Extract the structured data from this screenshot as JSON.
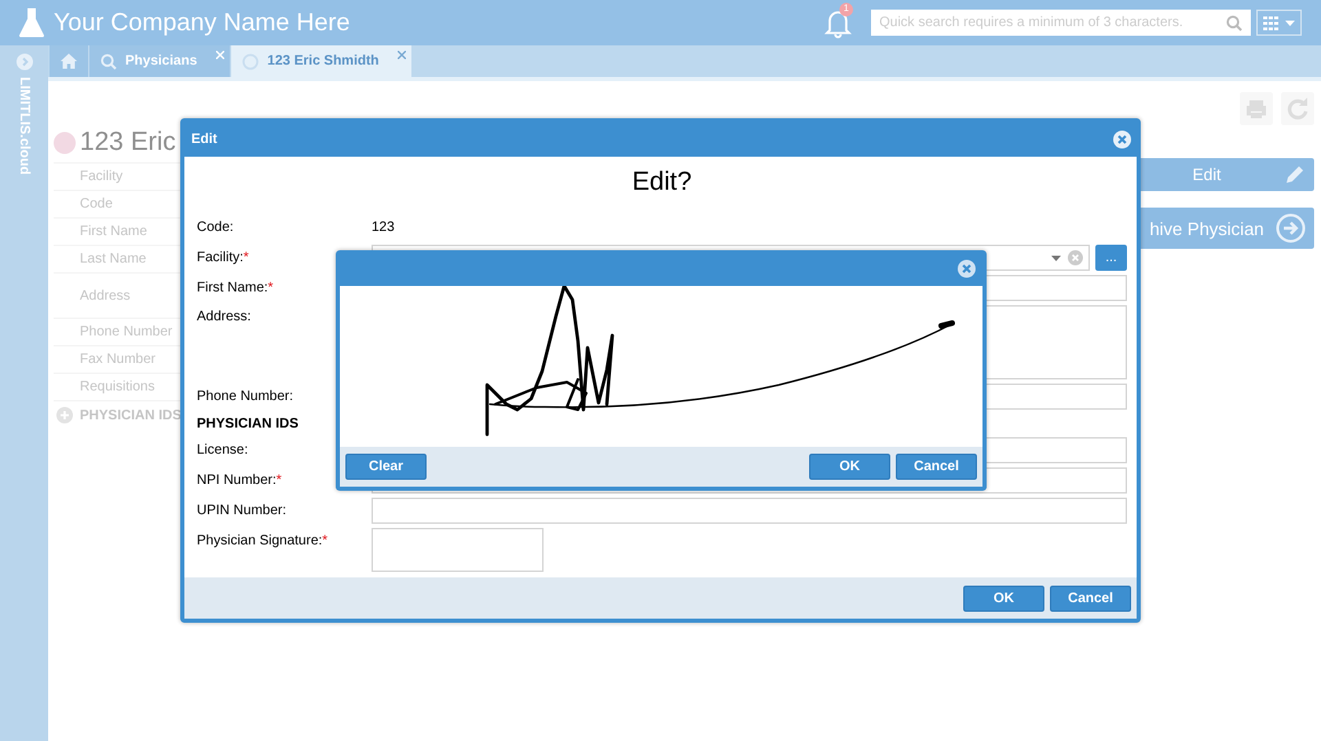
{
  "app": {
    "title": "Your Company Name Here",
    "notification_count": "1",
    "search": {
      "placeholder": "Quick search requires a minimum of 3 characters."
    }
  },
  "rail": {
    "label": "LIMITLIS.cloud"
  },
  "tabs": [
    {
      "kind": "home",
      "selected": false
    },
    {
      "kind": "search",
      "label": "Physicians",
      "selected": false,
      "closable": true
    },
    {
      "kind": "record",
      "label": "123 Eric Shmidth",
      "selected": true,
      "closable": true
    }
  ],
  "record": {
    "title": "123 Eric",
    "fields": [
      "Facility",
      "Code",
      "First Name",
      "Last Name",
      "Address",
      "Phone Number",
      "Fax Number",
      "Requisitions"
    ],
    "section": "PHYSICIAN IDS",
    "actions": [
      {
        "kind": "edit",
        "label": "Edit"
      },
      {
        "kind": "go",
        "label": "hive Physician"
      }
    ]
  },
  "edit_dialog": {
    "title": "Edit",
    "heading": "Edit?",
    "rows": [
      {
        "kind": "text",
        "label": "Code:",
        "value": "123"
      },
      {
        "kind": "select",
        "label": "Facility:",
        "mark": "*",
        "button": "..."
      },
      {
        "kind": "input",
        "label": "First Name:",
        "mark": "*"
      },
      {
        "kind": "textarea",
        "label": "Address:"
      },
      {
        "kind": "input",
        "label": "Phone Number:"
      },
      {
        "kind": "section",
        "label": "PHYSICIAN IDS"
      },
      {
        "kind": "input",
        "label": "License:"
      },
      {
        "kind": "input",
        "label": "NPI Number:",
        "mark": "*"
      },
      {
        "kind": "input",
        "label": "UPIN Number:"
      },
      {
        "kind": "signature",
        "label": "Physician Signature:",
        "mark": "*"
      }
    ],
    "buttons": [
      "OK",
      "Cancel"
    ]
  },
  "signature_dialog": {
    "buttons_left": [
      "Clear"
    ],
    "buttons_right": [
      "OK",
      "Cancel"
    ]
  }
}
